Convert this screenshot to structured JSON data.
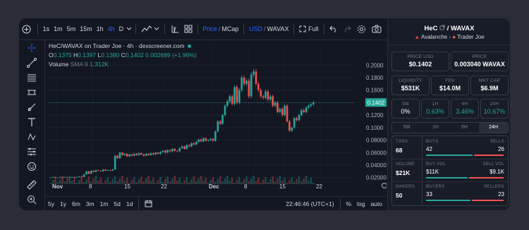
{
  "toolbar": {
    "timeframes": [
      "1s",
      "1m",
      "5m",
      "15m",
      "1h",
      "4h",
      "D"
    ],
    "active_timeframe": "4h",
    "price_label": "Price",
    "mcap_label": "MCap",
    "usd_label": "USD",
    "wavax_label": "WAVAX",
    "fullscreen_label": "Full"
  },
  "chart": {
    "title": "HeC/WAVAX on Trader Joe · 4h · dexscreener.com",
    "ohlc": {
      "o": "0.1375",
      "h": "0.1397",
      "l": "0.1380",
      "c": "0.1402",
      "change": "0.002699 (+1.96%)"
    },
    "volume_label": "Volume",
    "volume_ma": "SMA 9",
    "volume_value": "1.312K",
    "current_price": "0.1402",
    "time_display": "22:46:46 (UTC+1)",
    "ranges": [
      "5y",
      "1y",
      "6m",
      "3m",
      "1m",
      "5d",
      "1d"
    ],
    "pct_label": "%",
    "log_label": "log",
    "auto_label": "auto"
  },
  "chart_data": {
    "type": "candlestick",
    "title": "HeC/WAVAX on Trader Joe · 4h · dexscreener.com",
    "x_tick_labels": [
      "Nov",
      "8",
      "15",
      "22",
      "Dec",
      "8",
      "15",
      "22"
    ],
    "y_tick_labels": [
      "0.2000",
      "0.1800",
      "0.1600",
      "0.1400",
      "0.1200",
      "0.1000",
      "0.08000",
      "0.06000",
      "0.04000",
      "0.02000"
    ],
    "ylim": [
      0.014,
      0.206
    ],
    "last_price": 0.1402,
    "series": [
      {
        "name": "HeC/WAVAX",
        "values": [
          0.02,
          0.021,
          0.02,
          0.02,
          0.021,
          0.02,
          0.021,
          0.02,
          0.02,
          0.021,
          0.02,
          0.021,
          0.022,
          0.021,
          0.025,
          0.03,
          0.026,
          0.031,
          0.029,
          0.032,
          0.031,
          0.03,
          0.033,
          0.031,
          0.032,
          0.031,
          0.033,
          0.055,
          0.051,
          0.06,
          0.056,
          0.058,
          0.054,
          0.057,
          0.055,
          0.058,
          0.056,
          0.059,
          0.057,
          0.055,
          0.058,
          0.056,
          0.059,
          0.057,
          0.06,
          0.058,
          0.061,
          0.063,
          0.06,
          0.064,
          0.062,
          0.066,
          0.063,
          0.062,
          0.067,
          0.07,
          0.066,
          0.072,
          0.07,
          0.075,
          0.073,
          0.077,
          0.081,
          0.078,
          0.083,
          0.079,
          0.08,
          0.082,
          0.079,
          0.094,
          0.11,
          0.106,
          0.12,
          0.135,
          0.142,
          0.15,
          0.138,
          0.165,
          0.14,
          0.16,
          0.18,
          0.17,
          0.175,
          0.15,
          0.185,
          0.19,
          0.17,
          0.16,
          0.15,
          0.148,
          0.158,
          0.145,
          0.15,
          0.135,
          0.14,
          0.125,
          0.13,
          0.12,
          0.135,
          0.11,
          0.095,
          0.1,
          0.115,
          0.112,
          0.12,
          0.128,
          0.125,
          0.132,
          0.135,
          0.137,
          0.1402
        ]
      }
    ]
  },
  "panel": {
    "pair_name": "HeC",
    "pair_quote": "WAVAX",
    "chain": "Avalanche",
    "dex": "Trader Joe",
    "price_usd_label": "PRICE USD",
    "price_usd": "$0.1402",
    "price_label": "PRICE",
    "price_wavax": "0.003040 WAVAX",
    "liquidity_label": "LIQUIDITY",
    "liquidity": "$531K",
    "fdv_label": "FDV",
    "fdv": "$14.0M",
    "mktcap_label": "MKT CAP",
    "mktcap": "$6.9M",
    "changes": [
      {
        "label": "5M",
        "value": "0%"
      },
      {
        "label": "1H",
        "value": "0.63%"
      },
      {
        "label": "6H",
        "value": "3.46%"
      },
      {
        "label": "24H",
        "value": "10.67%"
      }
    ],
    "tabs": [
      "5M",
      "1H",
      "6H",
      "24H"
    ],
    "active_tab": "24H",
    "txns_label": "TXNS",
    "txns": "68",
    "buys_label": "BUYS",
    "buys": "42",
    "sells_label": "SELLS",
    "sells": "26",
    "volume_label": "VOLUME",
    "volume": "$21K",
    "buy_vol_label": "BUY VOL",
    "buy_vol": "$11K",
    "sell_vol_label": "SELL VOL",
    "sell_vol": "$9.1K",
    "makers_label": "MAKERS",
    "makers": "50",
    "buyers_label": "BUYERS",
    "buyers": "33",
    "sellers_label": "SELLERS",
    "sellers": "23",
    "buy_share": 0.618,
    "buy_vol_share": 0.55,
    "buyer_share": 0.59
  },
  "colors": {
    "up": "#26a69a",
    "down": "#ef5350",
    "accent": "#2962ff",
    "bg": "#131722"
  }
}
